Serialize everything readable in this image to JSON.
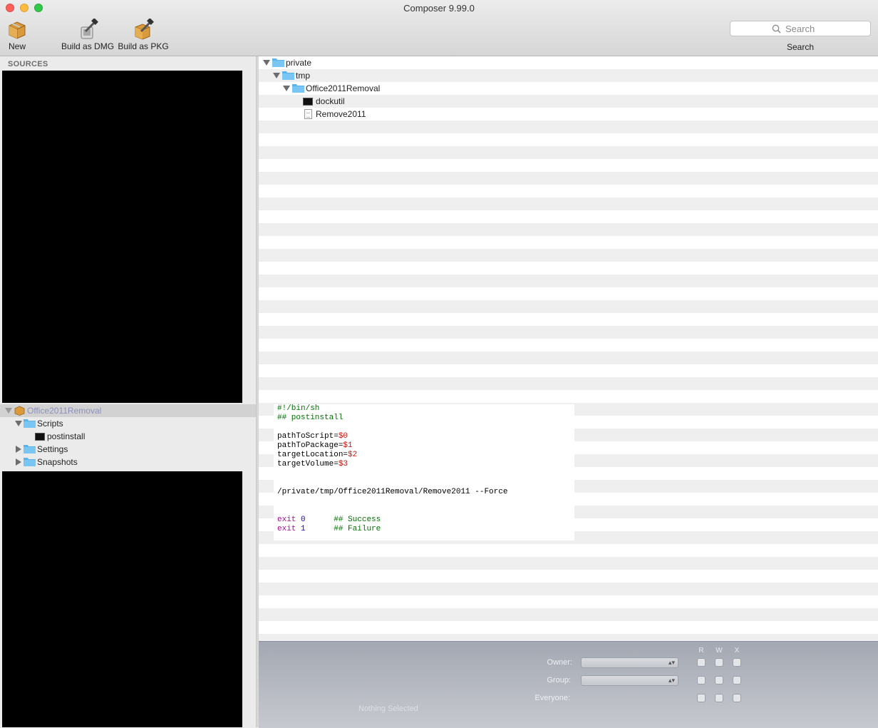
{
  "window": {
    "title": "Composer 9.99.0"
  },
  "toolbar": {
    "new_label": "New",
    "dmg_label": "Build as DMG",
    "pkg_label": "Build as PKG",
    "search_placeholder": "Search",
    "search_label": "Search"
  },
  "sidebar": {
    "sources_header": "SOURCES",
    "package": {
      "name": "Office2011Removal",
      "children": [
        {
          "label": "Scripts",
          "expanded": true,
          "icon": "folder-icon"
        },
        {
          "label": "postinstall",
          "icon": "terminal-icon"
        },
        {
          "label": "Settings",
          "expanded": false,
          "icon": "folder-icon"
        },
        {
          "label": "Snapshots",
          "expanded": false,
          "icon": "folder-icon"
        }
      ]
    }
  },
  "file_tree": {
    "items": [
      {
        "label": "private",
        "depth": 0,
        "icon": "folder-icon",
        "expanded": true
      },
      {
        "label": "tmp",
        "depth": 1,
        "icon": "folder-icon",
        "expanded": true
      },
      {
        "label": "Office2011Removal",
        "depth": 2,
        "icon": "folder-icon",
        "expanded": true
      },
      {
        "label": "dockutil",
        "depth": 3,
        "icon": "terminal-icon"
      },
      {
        "label": "Remove2011",
        "depth": 3,
        "icon": "document-icon"
      }
    ]
  },
  "script_editor": {
    "lines": [
      "#!/bin/sh",
      "## postinstall",
      "",
      "pathToScript=$0",
      "pathToPackage=$1",
      "targetLocation=$2",
      "targetVolume=$3",
      "",
      "",
      "/private/tmp/Office2011Removal/Remove2011 --Force",
      "",
      "",
      "exit 0      ## Success",
      "exit 1      ## Failure"
    ]
  },
  "permissions": {
    "owner_label": "Owner:",
    "group_label": "Group:",
    "everyone_label": "Everyone:",
    "col_r": "R",
    "col_w": "W",
    "col_x": "X",
    "status": "Nothing Selected"
  },
  "colors": {
    "folder": "#5bb3ea",
    "comment": "#007400",
    "variable": "#c41a16",
    "keyword": "#aa0d91",
    "number": "#1c00cf"
  }
}
